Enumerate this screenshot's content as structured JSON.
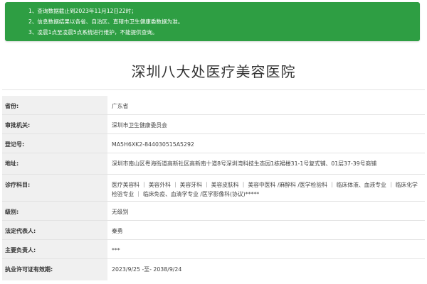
{
  "notice": {
    "lines": [
      "1、查询数据截止到2023年11月12日22时；",
      "2、信息数据结果以各省、自治区、直辖市卫生健康委数据为准。",
      "3、凌晨1点至凌晨5点系统进行维护，不能提供查询。"
    ],
    "bg_color": "#2e9e43"
  },
  "hospital": {
    "name": "深圳八大处医疗美容医院"
  },
  "fields": [
    {
      "label": "省份:",
      "value": "广东省"
    },
    {
      "label": "审批机关:",
      "value": "深圳市卫生健康委员会"
    },
    {
      "label": "登记号:",
      "value": "MA5H6XK2-844030515A5292"
    },
    {
      "label": "地址:",
      "value": "深圳市南山区粤海街道高新社区高新南十道8号深圳湾科技生态园1栋裙楼31-1号复式铺、01层37-39号商铺"
    },
    {
      "label": "诊疗科目:",
      "value": "医疗美容科 ｜ 美容外科 ｜ 美容牙科 ｜ 美容皮肤科 ｜ 美容中医科 /麻醉科 /医学检验科 ｜ 临床体液、血液专业 ｜ 临床化学检验专业 ｜ 临床免疫、血清学专业 /医学影像科(协议)*****"
    },
    {
      "label": "级别:",
      "value": "无级别"
    },
    {
      "label": "法定代表人:",
      "value": "秦勇"
    },
    {
      "label": "主要负责人:",
      "value": "***"
    },
    {
      "label": "执业许可证有效期:",
      "value": "2023/9/25 -至- 2038/9/24"
    }
  ]
}
